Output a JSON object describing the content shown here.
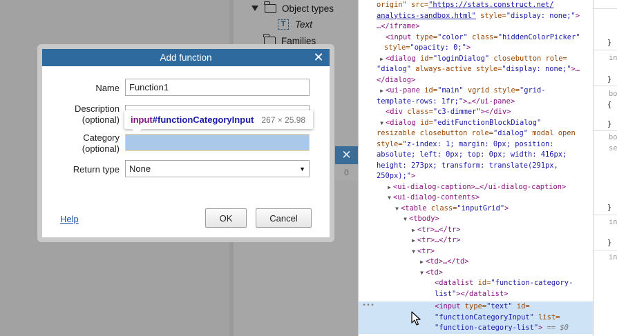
{
  "project_tree": {
    "object_types_label": "Object types",
    "text_label": "Text",
    "families_label": "Families"
  },
  "sub_dialog": {
    "count": "0"
  },
  "dialog": {
    "title": "Add function",
    "name_label": "Name",
    "name_value": "Function1",
    "description_label_1": "Description",
    "description_label_2": "(optional)",
    "category_label_1": "Category",
    "category_label_2": "(optional)",
    "return_type_label": "Return type",
    "return_type_value": "None",
    "help_label": "Help",
    "ok_label": "OK",
    "cancel_label": "Cancel"
  },
  "tooltip": {
    "tag": "input",
    "id": "#functionCategoryInput",
    "dims": "267 × 25.98"
  },
  "devtools": {
    "l0_attr": "origin\"",
    "l0_name": " src=",
    "l0_url1": "\"https://stats.construct.net/",
    "l1_url2": "analytics-sandbox.html\"",
    "l1_attr": " style=",
    "l1_val": "\"display: none;\"",
    "l1_end": ">",
    "l2": "…</iframe>",
    "l3_tag": "<input",
    "l3_a1": " type=",
    "l3_v1": "\"color\"",
    "l3_a2": " class=",
    "l3_v2": "\"hiddenColorPicker\"",
    "l4_a": "style=",
    "l4_v": "\"opacity: 0;\"",
    "l4_e": ">",
    "l5_tag": "<dialog",
    "l5_a1": " id=",
    "l5_v1": "\"loginDialog\"",
    "l5_a2": " closebutton",
    "l5_a3": " role=",
    "l6_v1": "\"dialog\"",
    "l6_a1": " always-active",
    "l6_a2": " style=",
    "l6_v2": "\"display: none;\"",
    "l6_e": ">…",
    "l7": "</dialog>",
    "l8_tag": "<ui-pane",
    "l8_a1": " id=",
    "l8_v1": "\"main\"",
    "l8_a2": " vgrid",
    "l8_a3": " style=",
    "l8_v2": "\"grid-",
    "l9_v": "template-rows: 1fr;\"",
    "l9_e": ">…</ui-pane>",
    "l10_tag": "<div",
    "l10_a": " class=",
    "l10_v": "\"c3-dimmer\"",
    "l10_e": "></div>",
    "l11_tag": "<dialog",
    "l11_a": " id=",
    "l11_v": "\"editFunctionBlockDialog\"",
    "l12_a1": "resizable",
    "l12_a2": " closebutton",
    "l12_a3": " role=",
    "l12_v": "\"dialog\"",
    "l12_a4": " modal",
    "l12_a5": " open",
    "l13_a": "style=",
    "l13_v": "\"z-index: 1; margin: 0px; position:",
    "l14_v": "absolute; left: 0px; top: 0px; width: 416px;",
    "l15_v": "height: 273px; transform: translate(291px,",
    "l16_v": "250px);\"",
    "l16_e": ">",
    "l17": "<ui-dialog-caption>…</ui-dialog-caption>",
    "l18": "<ui-dialog-contents>",
    "l19_tag": "<table",
    "l19_a": " class=",
    "l19_v": "\"inputGrid\"",
    "l19_e": ">",
    "l20": "<tbody>",
    "l21": "<tr>…</tr>",
    "l22": "<tr>…</tr>",
    "l23": "<tr>",
    "l24": "<td>…</td>",
    "l25": "<td>",
    "l26_tag": "<datalist",
    "l26_a": " id=",
    "l26_v": "\"function-category-",
    "l27_v": "list\"",
    "l27_e": "></datalist>",
    "l28_tag": "<input",
    "l28_a1": " type=",
    "l28_v1": "\"text\"",
    "l28_a2": " id=",
    "l29_v": "\"functionCategoryInput\"",
    "l29_a": " list=",
    "l30_v": "\"function-category-list\"",
    "l30_e": ">",
    "l30_eq": " == $0",
    "dots": "•••"
  },
  "styles_pane": {
    "s1": "}",
    "s2": "in",
    "s3": "}",
    "s4": "bo",
    "s5": "{",
    "s6": "}",
    "s7": "bo",
    "s8": "se",
    "s9": "}",
    "s10": "in",
    "s11": "}",
    "s12": "in"
  },
  "icons": [
    "expand-triangle-icon",
    "folder-icon",
    "text-object-icon",
    "close-icon",
    "dropdown-arrow-icon",
    "mouse-cursor-icon"
  ]
}
